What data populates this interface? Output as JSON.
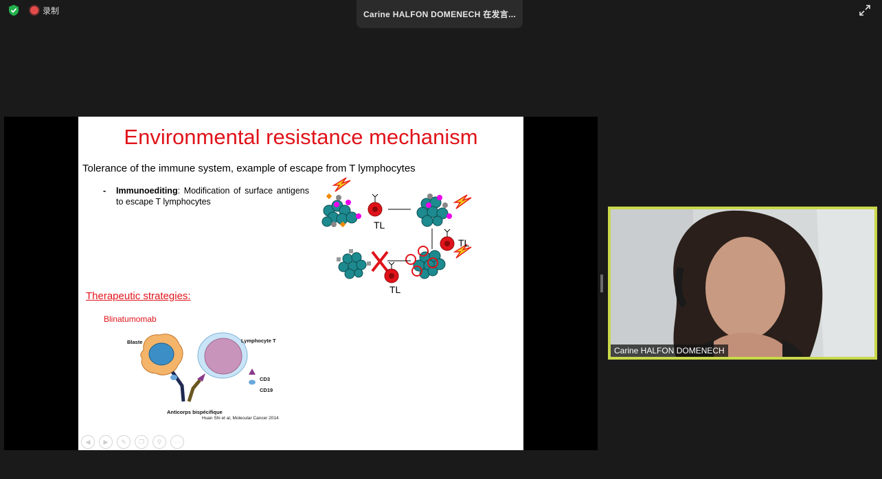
{
  "topbar": {
    "recording_label": "录制",
    "speaker_text": "Carine  HALFON  DOMENECH 在发言..."
  },
  "slide": {
    "title": "Environmental resistance mechanism",
    "subtitle": "Tolerance of the immune system, example of escape from T lymphocytes",
    "bullet_dash": "-",
    "bullet_bold": "Immunoediting",
    "bullet_text": ": Modification of surface antigens to escape T lymphocytes",
    "tl_label": "TL",
    "therapeutic": "Therapeutic strategies:",
    "drug": "Blinatumomab",
    "blaste": "Blaste",
    "lymphocyte": "Lymphocyte T",
    "cd3": "CD3",
    "cd19": "CD19",
    "antibody": "Anticorps bispécifique",
    "citation": "Huan Shi et al, Molecular Cancer 2014"
  },
  "video": {
    "participant_name": "Carine HALFON DOMENECH"
  },
  "colors": {
    "title_red": "#e0131a",
    "tile_border": "#c9d84a",
    "background": "#1a1a1a"
  },
  "icons": [
    "security-shield-icon",
    "record-dot-icon",
    "fullscreen-icon",
    "slide-prev-icon",
    "slide-next-icon",
    "slide-pen-icon",
    "slide-copy-icon",
    "slide-zoom-icon",
    "slide-more-icon"
  ]
}
